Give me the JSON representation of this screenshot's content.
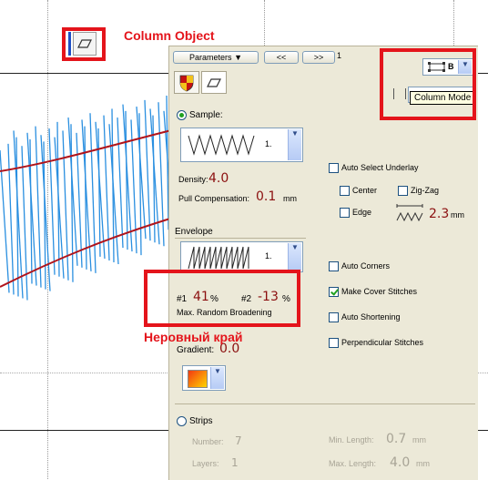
{
  "annotations": {
    "column_object": "Column Object",
    "uneven_edge": "Неровный край"
  },
  "toolbar": {
    "parameters_label": "Parameters",
    "prev_label": "<<",
    "next_label": ">>",
    "page_number": "1"
  },
  "mode": {
    "combo_value": "B",
    "tooltip": "Column Mode"
  },
  "sample": {
    "label": "Sample:",
    "pattern_number": "1."
  },
  "density": {
    "label": "Density:",
    "value": "4.0"
  },
  "pull_comp": {
    "label": "Pull Compensation:",
    "value": "0.1",
    "unit": "mm"
  },
  "underlay": {
    "auto_label": "Auto Select Underlay",
    "center_label": "Center",
    "zigzag_label": "Zig-Zag",
    "edge_label": "Edge",
    "spacing_value": "2.3",
    "spacing_unit": "mm"
  },
  "envelope": {
    "label": "Envelope",
    "pattern_number": "1.",
    "p1_label": "#1",
    "p1_value": "41",
    "p1_unit": "%",
    "p2_label": "#2",
    "p2_value": "-13",
    "p2_unit": "%",
    "broadening_label": "Max. Random Broadening"
  },
  "options": {
    "auto_corners": "Auto Corners",
    "make_cover": "Make Cover Stitches",
    "auto_shortening": "Auto Shortening",
    "perpendicular": "Perpendicular Stitches"
  },
  "gradient": {
    "label": "Gradient:",
    "value": "0.0"
  },
  "strips": {
    "label": "Strips",
    "number_label": "Number:",
    "number_value": "7",
    "layers_label": "Layers:",
    "layers_value": "1",
    "min_label": "Min. Length:",
    "min_value": "0.7",
    "min_unit": "mm",
    "max_label": "Max. Length:",
    "max_value": "4.0",
    "max_unit": "mm"
  },
  "colors": {
    "annotation_red": "#e4141b",
    "stitch_blue": "#2a8fe0",
    "outline_red": "#b0141b",
    "value_red": "#8b0f0f",
    "panel_bg": "#ece9d8"
  }
}
